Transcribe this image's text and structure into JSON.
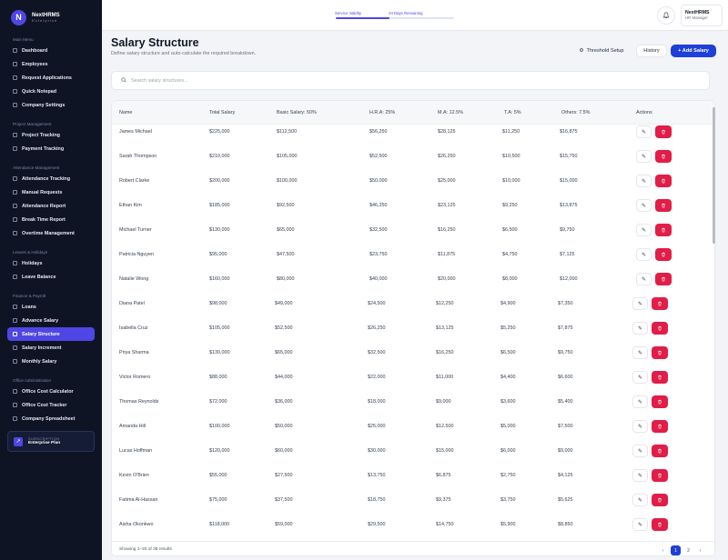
{
  "brand": {
    "logo_letter": "N",
    "name": "NextHRMS",
    "sub": "Enterprise"
  },
  "sidebar": {
    "sections": [
      {
        "title": "Main Menu",
        "items": [
          "Dashboard",
          "Employees",
          "Request Applications",
          "Quick Notepad",
          "Company Settings"
        ]
      },
      {
        "title": "Project Management",
        "items": [
          "Project Tracking",
          "Payment Tracking"
        ]
      },
      {
        "title": "Attendance Management",
        "items": [
          "Attendance Tracking",
          "Manual Requests",
          "Attendance Report",
          "Break Time Report",
          "Overtime Management"
        ]
      },
      {
        "title": "Leaves & Holidays",
        "items": [
          "Holidays",
          "Leave Balance"
        ]
      },
      {
        "title": "Finance & Payroll",
        "items": [
          "Loans",
          "Advance Salary",
          "Salary Structure",
          "Salary Increment",
          "Monthly Salary"
        ]
      },
      {
        "title": "Office Administration",
        "items": [
          "Office Cost Calculator",
          "Office Cost Tracker",
          "Company Spreadsheet"
        ]
      }
    ],
    "active_item": "Salary Structure",
    "plan": {
      "label": "SUBSCRIPTION",
      "value": "Enterprise Plan"
    }
  },
  "topbar": {
    "validity_label": "Service Validity",
    "days_remaining": "24 Days Remaining",
    "validity_fraction": 0.45,
    "user_name": "NextHRMS",
    "user_role": "HR Manager"
  },
  "page": {
    "title": "Salary Structure",
    "subtitle": "Define salary structure and auto-calculate the required breakdown.",
    "threshold_label": "Threshold Setup",
    "history_label": "History",
    "add_label": "+ Add Salary"
  },
  "search": {
    "placeholder": "Search salary structures..."
  },
  "table": {
    "columns": [
      "Name",
      "Total Salary",
      "Basic Salary: 50%",
      "H.R.A: 25%",
      "M.A: 12.5%",
      "T.A: 5%",
      "Others: 7.5%",
      "Actions"
    ],
    "rows": [
      [
        "James Michael",
        "$225,000",
        "$112,500",
        "$56,250",
        "$28,125",
        "$11,250",
        "$16,875"
      ],
      [
        "Sarah Thompson",
        "$210,000",
        "$105,000",
        "$52,500",
        "$26,250",
        "$10,500",
        "$15,750"
      ],
      [
        "Robert Clarke",
        "$200,000",
        "$100,000",
        "$50,000",
        "$25,000",
        "$10,000",
        "$15,000"
      ],
      [
        "Ethan Kim",
        "$185,000",
        "$92,500",
        "$46,250",
        "$23,125",
        "$9,250",
        "$13,875"
      ],
      [
        "Michael Turner",
        "$130,000",
        "$65,000",
        "$32,500",
        "$16,250",
        "$6,500",
        "$9,750"
      ],
      [
        "Patricia Nguyen",
        "$95,000",
        "$47,500",
        "$23,750",
        "$11,875",
        "$4,750",
        "$7,125"
      ],
      [
        "Natalie Wong",
        "$160,000",
        "$80,000",
        "$40,000",
        "$20,000",
        "$8,000",
        "$12,000"
      ],
      [
        "Diana Patel",
        "$98,000",
        "$49,000",
        "$24,500",
        "$12,250",
        "$4,900",
        "$7,350"
      ],
      [
        "Isabella Cruz",
        "$105,000",
        "$52,500",
        "$26,250",
        "$13,125",
        "$5,250",
        "$7,875"
      ],
      [
        "Priya Sharma",
        "$130,000",
        "$65,000",
        "$32,500",
        "$16,250",
        "$6,500",
        "$9,750"
      ],
      [
        "Victor Romero",
        "$88,000",
        "$44,000",
        "$22,000",
        "$11,000",
        "$4,400",
        "$6,600"
      ],
      [
        "Thomas Reynolds",
        "$72,000",
        "$36,000",
        "$18,000",
        "$9,000",
        "$3,600",
        "$5,400"
      ],
      [
        "Amanda Hill",
        "$100,000",
        "$50,000",
        "$25,000",
        "$12,500",
        "$5,000",
        "$7,500"
      ],
      [
        "Lucas Hoffman",
        "$120,000",
        "$60,000",
        "$30,000",
        "$15,000",
        "$6,000",
        "$9,000"
      ],
      [
        "Kevin O'Brien",
        "$55,000",
        "$27,500",
        "$13,750",
        "$6,875",
        "$2,750",
        "$4,125"
      ],
      [
        "Fatima Al-Hassan",
        "$75,000",
        "$37,500",
        "$18,750",
        "$9,375",
        "$3,750",
        "$5,625"
      ],
      [
        "Aisha Okonkwo",
        "$118,000",
        "$59,000",
        "$29,500",
        "$14,750",
        "$5,900",
        "$8,850"
      ]
    ],
    "footer_text": "Showing 1–20 of 38 results",
    "pagination": [
      "‹",
      "1",
      "2",
      "›"
    ],
    "current_page": "1"
  },
  "colors": {
    "accent": "#4f46e5",
    "primary_button": "#1e40d8",
    "danger": "#e11d48",
    "sidebar_bg": "#0f1425"
  }
}
